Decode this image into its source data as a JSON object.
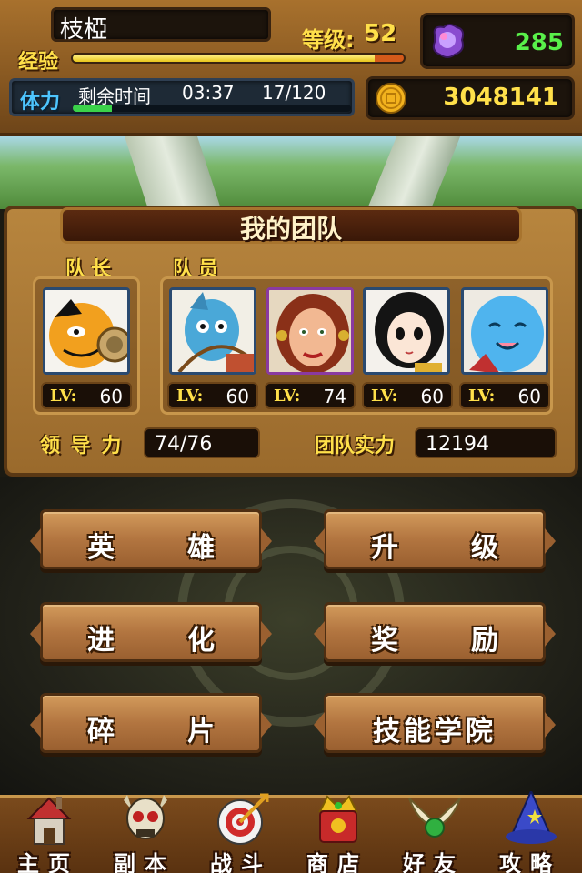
{
  "player": {
    "name": "枝椏",
    "exp_label": "经验",
    "level_label": "等级:",
    "level": "52",
    "exp_progress": 0.92,
    "gems": "285",
    "stamina_label": "体力",
    "stamina_remaining_label": "剩余时间",
    "stamina_timer": "03:37",
    "stamina_count": "17/120",
    "stamina_progress": 0.14,
    "gold": "3048141"
  },
  "team": {
    "title": "我的团队",
    "leader_label": "队长",
    "members_label": "队员",
    "lv_tag": "LV:",
    "leader": {
      "name": "leader-tiger-warrior",
      "level": "60"
    },
    "members": [
      {
        "name": "blue-fish-archer",
        "level": "60"
      },
      {
        "name": "red-haired-woman",
        "level": "74"
      },
      {
        "name": "black-haired-girl",
        "level": "60"
      },
      {
        "name": "blue-smiling-creature",
        "level": "60"
      }
    ],
    "leadership_label": "领 导 力",
    "leadership_value": "74/76",
    "power_label": "团队实力",
    "power_value": "12194"
  },
  "menu": {
    "heroes": [
      "英",
      "雄"
    ],
    "upgrade": [
      "升",
      "级"
    ],
    "evolve": [
      "进",
      "化"
    ],
    "reward": [
      "奖",
      "励"
    ],
    "fragments": [
      "碎",
      "片"
    ],
    "skill_academy": "技能学院"
  },
  "nav": {
    "home": "主页",
    "dungeon": "副本",
    "battle": "战斗",
    "shop": "商店",
    "friends": "好友",
    "guide": "攻略"
  },
  "colors": {
    "accent_yellow": "#ffe04a",
    "gem_green": "#59f04a",
    "stamina_blue": "#4ec6ff",
    "wood": "#b27540"
  }
}
